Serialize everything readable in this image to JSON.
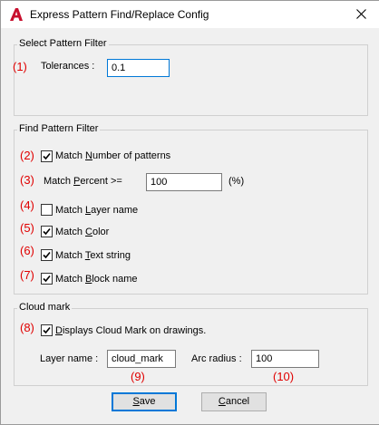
{
  "window": {
    "title": "Express Pattern Find/Replace Config",
    "app_icon": "autocad-a-icon",
    "close_icon": "close-icon"
  },
  "select_filter": {
    "group_label": "Select Pattern Filter",
    "marker": "(1)",
    "tolerances_label": "Tolerances :",
    "tolerances_value": "0.1"
  },
  "find_filter": {
    "group_label": "Find Pattern Filter",
    "match_number": {
      "marker": "(2)",
      "pre": "Match ",
      "mnemonic": "N",
      "post": "umber of patterns",
      "checked": true
    },
    "match_percent": {
      "marker": "(3)",
      "pre": "Match ",
      "mnemonic": "P",
      "post": "ercent  >=",
      "value": "100",
      "unit": "(%)"
    },
    "match_layer": {
      "marker": "(4)",
      "pre": "Match ",
      "mnemonic": "L",
      "post": "ayer name",
      "checked": false
    },
    "match_color": {
      "marker": "(5)",
      "pre": "Match ",
      "mnemonic": "C",
      "post": "olor",
      "checked": true
    },
    "match_text": {
      "marker": "(6)",
      "pre": "Match ",
      "mnemonic": "T",
      "post": "ext string",
      "checked": true
    },
    "match_block": {
      "marker": "(7)",
      "pre": "Match ",
      "mnemonic": "B",
      "post": "lock name",
      "checked": true
    }
  },
  "cloud_mark": {
    "group_label": "Cloud mark",
    "display": {
      "marker": "(8)",
      "mnemonic": "D",
      "post": "isplays Cloud Mark on drawings.",
      "checked": true
    },
    "layer_label": "Layer name :",
    "layer_value": "cloud_mark",
    "layer_marker": "(9)",
    "arc_label": "Arc radius :",
    "arc_value": "100",
    "arc_marker": "(10)"
  },
  "buttons": {
    "save": {
      "mnemonic": "S",
      "post": "ave"
    },
    "cancel": {
      "mnemonic": "C",
      "post": "ancel"
    }
  },
  "colors": {
    "marker": "#e00000",
    "accent": "#0078d7",
    "logo": "#c8102e"
  }
}
